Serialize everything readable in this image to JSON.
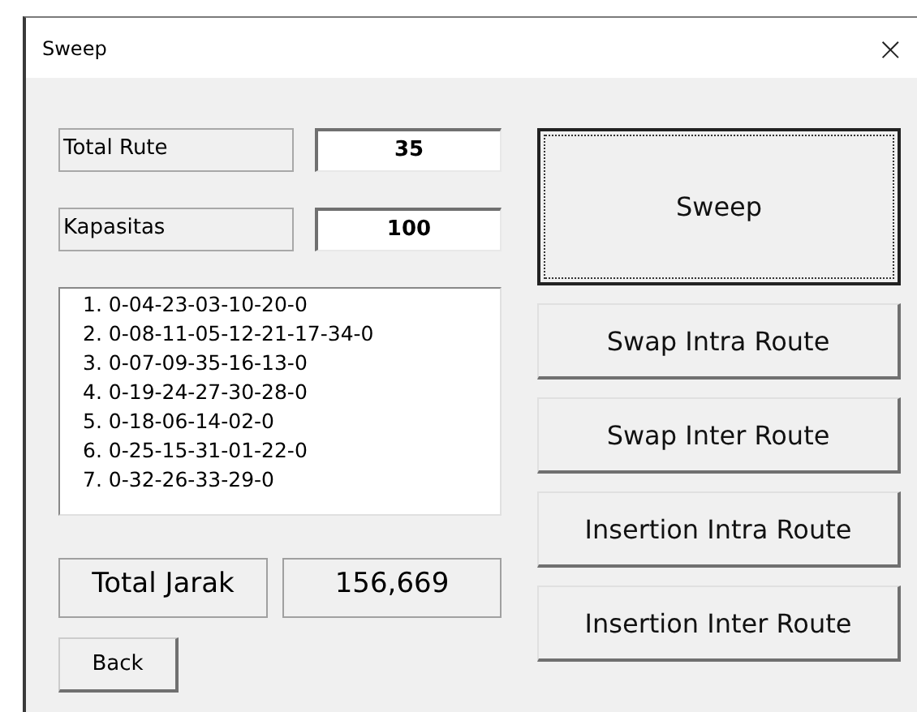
{
  "window": {
    "title": "Sweep",
    "close": "×"
  },
  "fields": [
    {
      "label": "Total Rute",
      "value": "35"
    },
    {
      "label": "Kapasitas",
      "value": "100"
    }
  ],
  "routes": [
    "1. 0-04-23-03-10-20-0",
    "2. 0-08-11-05-12-21-17-34-0",
    "3. 0-07-09-35-16-13-0",
    "4. 0-19-24-27-30-28-0",
    "5. 0-18-06-14-02-0",
    "6. 0-25-15-31-01-22-0",
    "7. 0-32-26-33-29-0"
  ],
  "total": {
    "label": "Total Jarak",
    "value": "156,669"
  },
  "back_button": "Back",
  "buttons": [
    {
      "label": "Sweep",
      "focused": true
    },
    {
      "label": "Swap Intra Route",
      "focused": false
    },
    {
      "label": "Swap Inter Route",
      "focused": false
    },
    {
      "label": "Insertion Intra Route",
      "focused": false
    },
    {
      "label": "Insertion Inter Route",
      "focused": false
    }
  ]
}
